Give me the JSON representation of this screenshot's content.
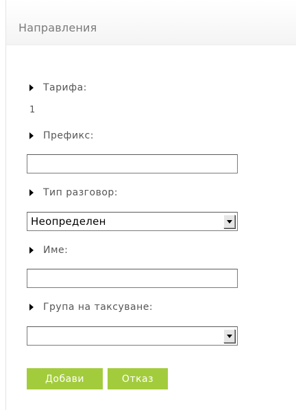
{
  "panel": {
    "title": "Направления"
  },
  "form": {
    "tariff": {
      "label": "Тарифа:",
      "value": "1"
    },
    "prefix": {
      "label": "Префикс:",
      "value": ""
    },
    "call_type": {
      "label": "Тип разговор:",
      "selected": "Неопределен"
    },
    "name": {
      "label": "Име:",
      "value": ""
    },
    "billing_group": {
      "label": "Група на таксуване:",
      "selected": ""
    }
  },
  "buttons": {
    "add_label": "Добави",
    "cancel_label": "Отказ"
  },
  "colors": {
    "button_bg": "#a3cc3d",
    "title_text": "#7a7a7a",
    "label_text": "#555555"
  }
}
